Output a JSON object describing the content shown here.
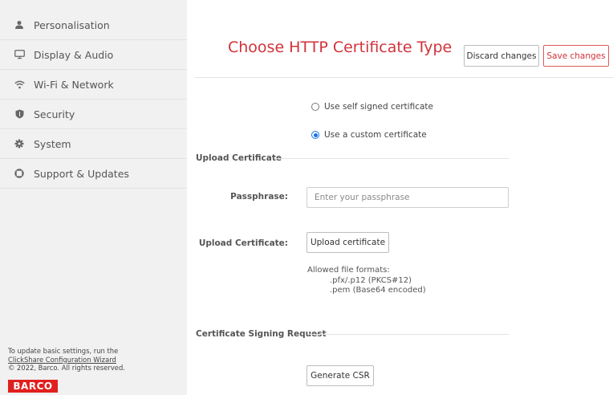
{
  "sidebar": {
    "items": [
      {
        "label": "Personalisation",
        "icon": "person-icon"
      },
      {
        "label": "Display & Audio",
        "icon": "monitor-icon"
      },
      {
        "label": "Wi-Fi & Network",
        "icon": "wifi-icon"
      },
      {
        "label": "Security",
        "icon": "shield-icon"
      },
      {
        "label": "System",
        "icon": "gear-icon"
      },
      {
        "label": "Support & Updates",
        "icon": "lifebuoy-icon"
      }
    ],
    "footer": {
      "line1": "To update basic settings, run the",
      "link": "ClickShare Configuration Wizard",
      "copyright": "© 2022, Barco. All rights reserved.",
      "logo": "BARCO"
    }
  },
  "main": {
    "title": "Choose HTTP Certificate Type",
    "discard_label": "Discard changes",
    "save_label": "Save changes",
    "options": [
      {
        "label": "Use self signed certificate",
        "selected": false
      },
      {
        "label": "Use a custom certificate",
        "selected": true
      }
    ],
    "upload_section_title": "Upload Certificate",
    "passphrase_label": "Passphrase:",
    "passphrase_placeholder": "Enter your passphrase",
    "upload_label": "Upload Certificate:",
    "upload_button": "Upload certificate",
    "formats_title": "Allowed file formats:",
    "format_1": ".pfx/.p12 (PKCS#12)",
    "format_2": ".pem (Base64 encoded)",
    "csr_section_title": "Certificate Signing Request",
    "csr_button": "Generate CSR"
  },
  "colors": {
    "accent": "#d1323a",
    "radio_selected": "#1a73e8",
    "sidebar_bg": "#f1f1f1",
    "logo_bg": "#e0201f"
  }
}
